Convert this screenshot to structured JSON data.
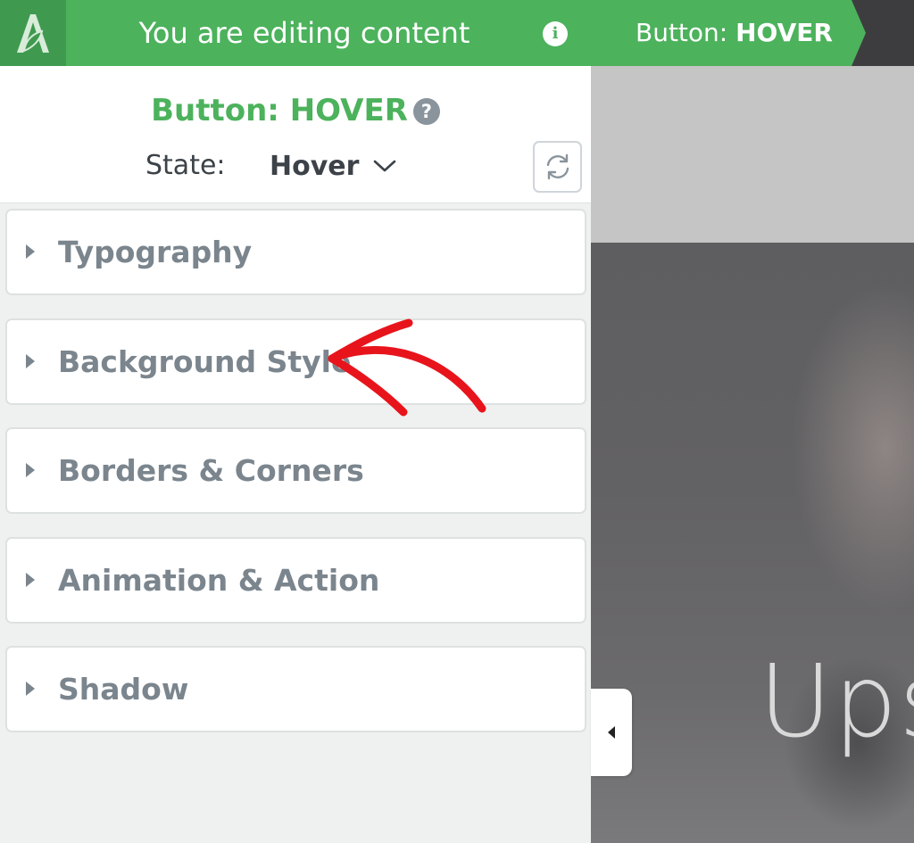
{
  "topbar": {
    "editing_title": "You are editing content",
    "breadcrumb_prefix": "Button: ",
    "breadcrumb_state": "HOVER"
  },
  "panel": {
    "element_title": "Button: HOVER",
    "state_label": "State:",
    "state_value": "Hover",
    "sections": [
      {
        "label": "Typography"
      },
      {
        "label": "Background Style"
      },
      {
        "label": "Borders & Corners"
      },
      {
        "label": "Animation & Action"
      },
      {
        "label": "Shadow"
      }
    ]
  },
  "preview": {
    "hero_text": "Ups"
  },
  "icons": {
    "logo": "leaf-a-logo-icon",
    "info": "info-icon",
    "help": "help-question-icon",
    "state_dropdown": "chevron-down-icon",
    "reset": "refresh-icon",
    "section_caret": "caret-right-icon",
    "collapse": "caret-left-icon"
  },
  "colors": {
    "brand_green": "#4cb25c",
    "logo_green": "#3f9a4f",
    "dark_bar": "#3d3d40",
    "section_label": "#7b858d",
    "annotation_red": "#e8141c"
  }
}
